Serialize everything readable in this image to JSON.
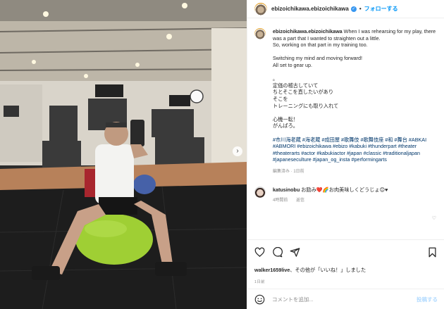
{
  "post": {
    "username": "ebizoichikawa.ebizoichikawa",
    "follow_label": "フォローする",
    "dot": "•",
    "verified_glyph": "✓"
  },
  "caption": {
    "username": "ebizoichikawa.ebizoichikawa",
    "lines_en": [
      "When I was rehearsing for my play, there was a part that I wanted to straighten out a little.",
      "So, working on that part in my training too.",
      "",
      "Switching my mind and moving forward!",
      "All set to gear up.",
      "",
      "。",
      "定価の稽古していて",
      "ちとそこを直したいがあり",
      "そこを",
      "トレーニングにも取り入れて",
      "",
      "心機一転！",
      "がんばろ。"
    ],
    "hashtags": "#市川海老蔵 #海老蔵 #成田屋 #歌舞伎 #歌舞伎座 #和 #舞台 #ABKAI #ABMORI #ebizoichikawa #ebizo #kabuki #thunderpart #theater #theaterarts #actor #kabukiactor #japan #classic #traditionaljapan #japaneseculture #japan_og_insta #performingarts",
    "meta": "編集済み · 1日前"
  },
  "reply": {
    "username": "katusinobu",
    "text": "お励み❤️🌈お肉美味しくどうじょ😊♥",
    "time": "4時間前",
    "reply_label": "返信"
  },
  "actions": {
    "icons": [
      "heart-icon",
      "comment-icon",
      "share-icon",
      "bookmark-icon"
    ]
  },
  "likes": {
    "user": "walker1659live",
    "text": "、その他が「いいね！」しました"
  },
  "timestamp": "1日前",
  "comment_box": {
    "placeholder": "コメントを追加...",
    "post_label": "投稿する"
  },
  "colors": {
    "link": "#00376b",
    "follow": "#0095f6",
    "muted": "#8e8e8e"
  }
}
